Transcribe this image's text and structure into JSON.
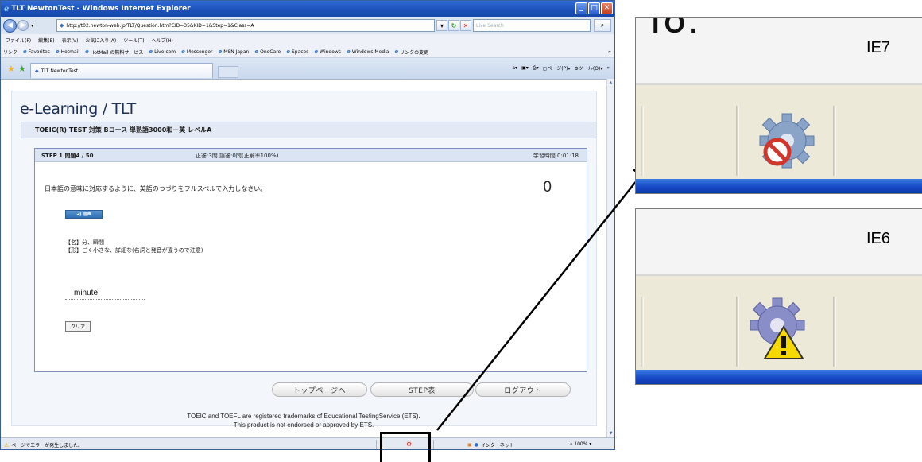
{
  "browser": {
    "title": "TLT NewtonTest - Windows Internet Explorer",
    "url": "http://t02.newton-web.jp/TLT/Question.htm?CID=35&KID=1&Step=1&Class=A",
    "search_placeholder": "Live Search",
    "menu": [
      "ファイル(F)",
      "編集(E)",
      "表示(V)",
      "お気に入り(A)",
      "ツール(T)",
      "ヘルプ(H)"
    ],
    "links_label": "リンク",
    "links": [
      "Favorites",
      "Hotmail",
      "HotMail の無料サービス",
      "Live.com",
      "Messenger",
      "MSN Japan",
      "OneCare",
      "Spaces",
      "Windows",
      "Windows Media",
      "リンクの変更"
    ],
    "tab_title": "TLT NewtonTest",
    "cmd_page": "ページ(P)",
    "cmd_tools": "ツール(O)"
  },
  "page": {
    "logo": "e-Learning / TLT",
    "course": "TOEIC(R) TEST 対策 Bコース 単熟語3000和－英 レベルA",
    "step_label": "STEP 1 問題4 / 50",
    "stats": "正答:3問 誤答:0問(正解率100%)",
    "time": "学習時間 0:01:18",
    "instruction": "日本語の意味に対応するように、英語のつづりをフルスペルで入力しなさい。",
    "score": "0",
    "audio_label": "音声",
    "def_noun": "【名】分、瞬間",
    "def_adj": "【形】ごく小さな、詳細な(名詞と発音が違うので注意)",
    "answer": "minute",
    "clear": "クリア",
    "buttons": [
      "トップページへ",
      "STEP表",
      "ログアウト"
    ],
    "footer1": "TOEIC and TOEFL are registered trademarks of Educational TestingService (ETS).",
    "footer2": "This product is not endorsed or approved by ETS."
  },
  "status": {
    "message": "ページでエラーが発生しました。",
    "zone": "インターネット",
    "zoom": "100%"
  },
  "panels": {
    "ie7_label": "IE7",
    "ie6_label": "IE6",
    "ie7_icon": "gear-with-prohibition-icon",
    "ie6_icon": "gear-with-warning-icon"
  },
  "colors": {
    "title_bar": "#1b4fb8",
    "status_blue": "#1546c4",
    "prohibit_red": "#d0362a",
    "warning_yellow": "#f5d800"
  }
}
